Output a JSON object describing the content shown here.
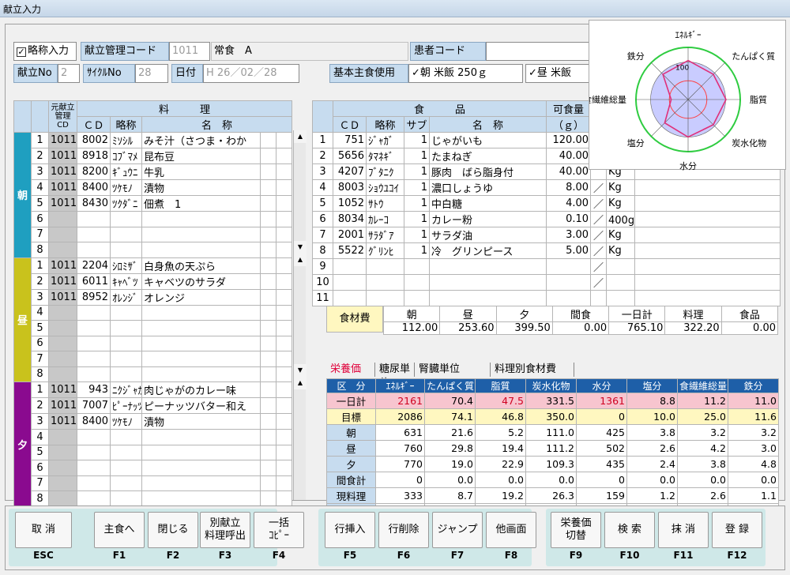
{
  "window": {
    "title": "献立入力"
  },
  "header": {
    "abbrev_check": "✓",
    "abbrev_label": "略称入力",
    "menu_code_label": "献立管理コード",
    "menu_code_value": "1011",
    "menu_name": "常食　A",
    "patient_code_label": "患者コード",
    "menu_no_label": "献立No",
    "menu_no_value": "2",
    "cycle_no_label": "ｻｲｸﾙNo",
    "cycle_no_value": "28",
    "date_label": "日付",
    "date_value": "H 26／02／28",
    "staple_label": "基本主食使用",
    "staple_morning": "✓朝 米飯 250ｇ",
    "staple_noon": "✓昼 米飯"
  },
  "menu_table": {
    "headers": {
      "orig": "元献立管理CD",
      "dish": "料　　　理",
      "cd": "ＣＤ",
      "abbr": "略称",
      "name": "名　称"
    },
    "meals": [
      {
        "label": "朝",
        "color": "#1f9fc0",
        "rows": [
          [
            "1",
            "1011",
            "8002",
            "ﾐｿｼﾙ",
            "みそ汁（さつま・わか"
          ],
          [
            "2",
            "1011",
            "8918",
            "ｺﾌﾞﾏﾒ",
            "昆布豆"
          ],
          [
            "3",
            "1011",
            "8200",
            "ｷﾞｭｳﾆ",
            "牛乳"
          ],
          [
            "4",
            "1011",
            "8400",
            "ﾂｹﾓﾉ",
            "漬物"
          ],
          [
            "5",
            "1011",
            "8430",
            "ﾂｸﾀﾞﾆ",
            "佃煮　1"
          ],
          [
            "6",
            "",
            "",
            "",
            ""
          ],
          [
            "7",
            "",
            "",
            "",
            ""
          ],
          [
            "8",
            "",
            "",
            "",
            ""
          ]
        ]
      },
      {
        "label": "昼",
        "color": "#c9c21c",
        "rows": [
          [
            "1",
            "1011",
            "2204",
            "ｼﾛﾐｻﾞ",
            "白身魚の天ぷら"
          ],
          [
            "2",
            "1011",
            "6011",
            "ｷｬﾍﾞﾂ",
            "キャベツのサラダ"
          ],
          [
            "3",
            "1011",
            "8952",
            "ｵﾚﾝｼﾞ",
            "オレンジ"
          ],
          [
            "4",
            "",
            "",
            "",
            ""
          ],
          [
            "5",
            "",
            "",
            "",
            ""
          ],
          [
            "6",
            "",
            "",
            "",
            ""
          ],
          [
            "7",
            "",
            "",
            "",
            ""
          ],
          [
            "8",
            "",
            "",
            "",
            ""
          ]
        ]
      },
      {
        "label": "夕",
        "color": "#8a0a8f",
        "rows": [
          [
            "1",
            "1011",
            "943",
            "ﾆｸｼﾞｬｶﾞ",
            "肉じゃがのカレー味"
          ],
          [
            "2",
            "1011",
            "7007",
            "ﾋﾟｰﾅｯﾂ",
            "ピーナッツバター和え"
          ],
          [
            "3",
            "1011",
            "8400",
            "ﾂｹﾓﾉ",
            "漬物"
          ],
          [
            "4",
            "",
            "",
            "",
            ""
          ],
          [
            "5",
            "",
            "",
            "",
            ""
          ],
          [
            "6",
            "",
            "",
            "",
            ""
          ],
          [
            "7",
            "",
            "",
            "",
            ""
          ],
          [
            "8",
            "",
            "",
            "",
            ""
          ]
        ]
      }
    ]
  },
  "food_table": {
    "headers": {
      "food": "食　　　品",
      "cd": "ＣＤ",
      "abbr": "略称",
      "sub": "サブ",
      "name": "名　称",
      "edible": "可食量",
      "unit": "（ｇ）"
    },
    "rows": [
      [
        "1",
        "751",
        "ｼﾞｬｶﾞ",
        "1",
        "じゃがいも",
        "120.00",
        "",
        ""
      ],
      [
        "2",
        "5656",
        "ﾀﾏﾈｷﾞ",
        "1",
        "たまねぎ",
        "40.00",
        "",
        ""
      ],
      [
        "3",
        "4207",
        "ﾌﾞﾀﾆｸ",
        "1",
        "豚肉　ばら脂身付",
        "40.00",
        "",
        "Kg"
      ],
      [
        "4",
        "8003",
        "ｼｮｳﾕｺｲ",
        "1",
        "濃口しょうゆ",
        "8.00",
        "／",
        "Kg"
      ],
      [
        "5",
        "1052",
        "ｻﾄｳ",
        "1",
        "中白糖",
        "4.00",
        "／",
        "Kg"
      ],
      [
        "6",
        "8034",
        "ｶﾚｰｺ",
        "1",
        "カレー粉",
        "0.10",
        "／",
        "400g/缶"
      ],
      [
        "7",
        "2001",
        "ｻﾗﾀﾞｱ",
        "1",
        "サラダ油",
        "3.00",
        "／",
        "Kg"
      ],
      [
        "8",
        "5522",
        "ｸﾞﾘﾝﾋ",
        "1",
        "冷　グリンピース",
        "5.00",
        "／",
        "Kg"
      ],
      [
        "9",
        "",
        "",
        "",
        "",
        "",
        "／",
        ""
      ],
      [
        "10",
        "",
        "",
        "",
        "",
        "",
        "／",
        ""
      ],
      [
        "11",
        "",
        "",
        "",
        "",
        "",
        "",
        ""
      ]
    ]
  },
  "cost": {
    "label": "食材費",
    "headers": [
      "朝",
      "昼",
      "夕",
      "間食",
      "一日計",
      "料理",
      "食品"
    ],
    "values": [
      "112.00",
      "253.60",
      "399.50",
      "0.00",
      "765.10",
      "322.20",
      "0.00"
    ]
  },
  "nutrition": {
    "tabs": [
      "栄養価",
      "糖尿単位",
      "腎臓単位",
      "料理別食材費"
    ],
    "headers": [
      "区　分",
      "ｴﾈﾙｷﾞｰ",
      "たんぱく質",
      "脂質",
      "炭水化物",
      "水分",
      "塩分",
      "食繊維総量",
      "鉄分"
    ],
    "rows": [
      {
        "label": "一日計",
        "values": [
          "2161",
          "70.4",
          "47.5",
          "331.5",
          "1361",
          "8.8",
          "11.2",
          "11.0"
        ]
      },
      {
        "label": "目標",
        "values": [
          "2086",
          "74.1",
          "46.8",
          "350.0",
          "0",
          "10.0",
          "25.0",
          "11.6"
        ]
      },
      {
        "label": "朝",
        "values": [
          "631",
          "21.6",
          "5.2",
          "111.0",
          "425",
          "3.8",
          "3.2",
          "3.2"
        ]
      },
      {
        "label": "昼",
        "values": [
          "760",
          "29.8",
          "19.4",
          "111.2",
          "502",
          "2.6",
          "4.2",
          "3.0"
        ]
      },
      {
        "label": "夕",
        "values": [
          "770",
          "19.0",
          "22.9",
          "109.3",
          "435",
          "2.4",
          "3.8",
          "4.8"
        ]
      },
      {
        "label": "間食計",
        "values": [
          "0",
          "0.0",
          "0.0",
          "0.0",
          "0",
          "0.0",
          "0.0",
          "0.0"
        ]
      },
      {
        "label": "現料理",
        "values": [
          "333",
          "8.7",
          "19.2",
          "26.3",
          "159",
          "1.2",
          "2.6",
          "1.1"
        ]
      },
      {
        "label": "現食品",
        "values": [
          "",
          "",
          "",
          "",
          "",
          "",
          "",
          ""
        ]
      }
    ]
  },
  "radar": {
    "labels": [
      "ｴﾈﾙｷﾞｰ",
      "たんぱく質",
      "脂質",
      "炭水化物",
      "水分",
      "塩分",
      "食繊維総量",
      "鉄分"
    ],
    "scale_label": "100",
    "values_pct": [
      104,
      95,
      101,
      95,
      100,
      88,
      45,
      95
    ],
    "colors": {
      "fill": "#c9ccff",
      "line": "#e0307a",
      "outer": "#2ecc40",
      "ring": "#ff4040"
    }
  },
  "footer": {
    "buttons": [
      {
        "label": "取 消",
        "key": "ESC"
      },
      {
        "label": "主食へ",
        "key": "F1"
      },
      {
        "label": "閉じる",
        "key": "F2"
      },
      {
        "label": "別献立\n料理呼出",
        "key": "F3"
      },
      {
        "label": "一括\nｺﾋﾟｰ",
        "key": "F4"
      },
      {
        "label": "行挿入",
        "key": "F5"
      },
      {
        "label": "行削除",
        "key": "F6"
      },
      {
        "label": "ジャンプ",
        "key": "F7"
      },
      {
        "label": "他画面",
        "key": "F8"
      },
      {
        "label": "栄養価\n切替",
        "key": "F9"
      },
      {
        "label": "検 索",
        "key": "F10"
      },
      {
        "label": "抹 消",
        "key": "F11"
      },
      {
        "label": "登 録",
        "key": "F12"
      }
    ]
  }
}
